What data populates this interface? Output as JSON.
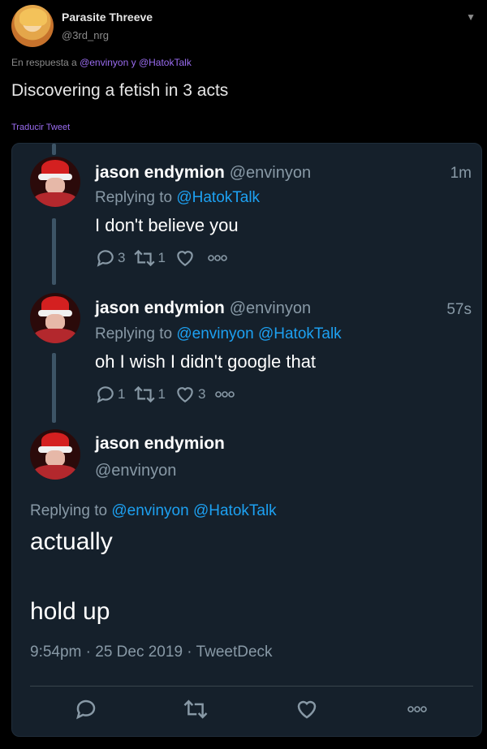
{
  "tweet": {
    "display_name": "Parasite Threeve",
    "handle": "@3rd_nrg",
    "reply_prefix": "En respuesta a",
    "reply_users": "@envinyon y @HatokTalk",
    "text": "Discovering a fetish in 3 acts",
    "translate": "Traducir Tweet"
  },
  "embedded": {
    "tweets": [
      {
        "name": "jason endymion",
        "handle": "@envinyon",
        "time": "1m",
        "replying_prefix": "Replying to",
        "replying_users": "@HatokTalk",
        "text": "I don't believe you",
        "replies": "3",
        "retweets": "1",
        "likes": ""
      },
      {
        "name": "jason endymion",
        "handle": "@envinyon",
        "time": "57s",
        "replying_prefix": "Replying to",
        "replying_users": "@envinyon @HatokTalk",
        "text": "oh I wish I didn't google that",
        "replies": "1",
        "retweets": "1",
        "likes": "3"
      }
    ],
    "main": {
      "name": "jason endymion",
      "handle": "@envinyon",
      "replying_prefix": "Replying to",
      "replying_users": "@envinyon @HatokTalk",
      "line1": "actually",
      "line2": "hold up",
      "meta": "9:54pm · 25 Dec 2019 · TweetDeck"
    }
  },
  "colors": {
    "accent_purple": "#9a6cf0",
    "link_blue": "#1da1f2",
    "card_bg": "#15202b"
  }
}
